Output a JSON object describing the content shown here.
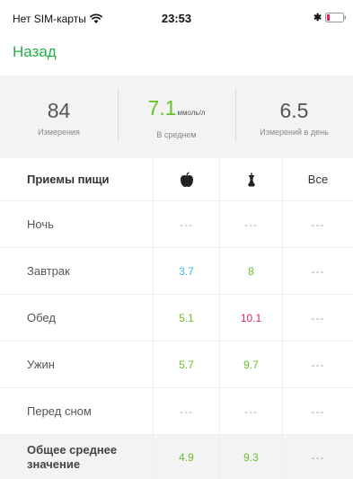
{
  "status": {
    "carrier": "Нет SIM-карты",
    "time": "23:53",
    "bluetooth": "✱"
  },
  "nav": {
    "back_label": "Назад"
  },
  "summary": [
    {
      "value": "84",
      "unit": "",
      "label": "Измерения"
    },
    {
      "value": "7.1",
      "unit": "ммоль/л",
      "label": "В среднем"
    },
    {
      "value": "6.5",
      "unit": "",
      "label": "Измерений в день"
    }
  ],
  "colors": {
    "accent": "#23b04a",
    "green": "#6abf2a",
    "blue": "#3fb8e8",
    "red": "#e0245e",
    "dash": "#aaaaaa"
  },
  "table": {
    "header": {
      "title": "Приемы пищи",
      "col1_icon": "apple-icon",
      "col2_icon": "apple-core-icon",
      "col3": "Все"
    },
    "rows": [
      {
        "name": "Ночь",
        "c1": "---",
        "c2": "---",
        "c3": "---"
      },
      {
        "name": "Завтрак",
        "c1": "3.7",
        "c2": "8",
        "c3": "---"
      },
      {
        "name": "Обед",
        "c1": "5.1",
        "c2": "10.1",
        "c3": "---"
      },
      {
        "name": "Ужин",
        "c1": "5.7",
        "c2": "9.7",
        "c3": "---"
      },
      {
        "name": "Перед сном",
        "c1": "---",
        "c2": "---",
        "c3": "---"
      }
    ],
    "footer": {
      "name": "Общее среднее значение",
      "c1": "4.9",
      "c2": "9.3",
      "c3": "---"
    }
  }
}
